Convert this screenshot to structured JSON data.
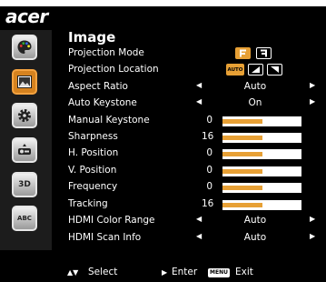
{
  "brand": "acer",
  "menu_title": "Image",
  "sidebar": {
    "items": [
      {
        "name": "color-palette-icon"
      },
      {
        "name": "image-icon",
        "active": true
      },
      {
        "name": "settings-gear-icon"
      },
      {
        "name": "management-icon"
      },
      {
        "name": "3d-icon",
        "label": "3D"
      },
      {
        "name": "language-icon",
        "label": "ABC"
      }
    ]
  },
  "rows": {
    "projection_mode": {
      "label": "Projection Mode"
    },
    "projection_location": {
      "label": "Projection Location",
      "auto_chip": "AUTO"
    },
    "aspect_ratio": {
      "label": "Aspect Ratio",
      "value": "Auto"
    },
    "auto_keystone": {
      "label": "Auto Keystone",
      "value": "On"
    },
    "manual_keystone": {
      "label": "Manual Keystone",
      "value": "0",
      "level": 0.5
    },
    "sharpness": {
      "label": "Sharpness",
      "value": "16",
      "level": 0.5
    },
    "h_position": {
      "label": "H. Position",
      "value": "0",
      "level": 0.5
    },
    "v_position": {
      "label": "V. Position",
      "value": "0",
      "level": 0.5
    },
    "frequency": {
      "label": "Frequency",
      "value": "0",
      "level": 0.5
    },
    "tracking": {
      "label": "Tracking",
      "value": "16",
      "level": 0.5
    },
    "hdmi_color_range": {
      "label": "HDMI Color Range",
      "value": "Auto"
    },
    "hdmi_scan_info": {
      "label": "HDMI Scan Info",
      "value": "Auto"
    }
  },
  "footer": {
    "select_label": "Select",
    "enter_label": "Enter",
    "menu_badge": "MENU",
    "exit_label": "Exit"
  },
  "colors": {
    "accent": "#e7a035",
    "background": "#000000",
    "text": "#ffffff"
  }
}
